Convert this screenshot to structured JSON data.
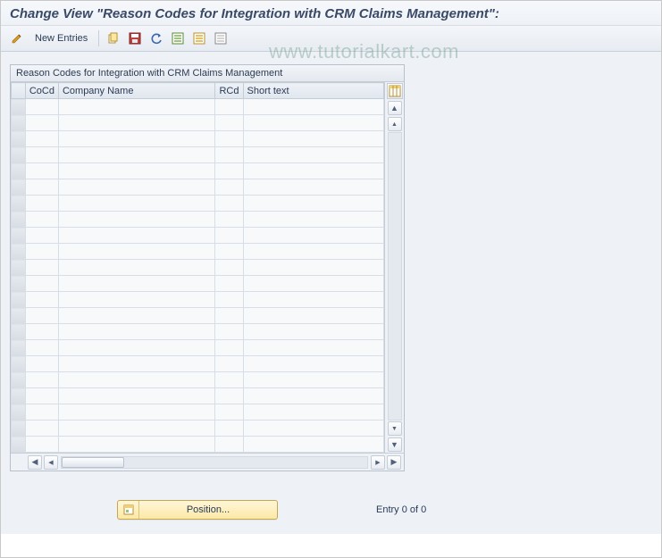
{
  "title": "Change View \"Reason Codes for Integration with CRM Claims Management\":",
  "toolbar": {
    "new_entries": "New Entries"
  },
  "watermark": "www.tutorialkart.com",
  "panel": {
    "header": "Reason Codes for Integration with CRM Claims Management",
    "columns": {
      "cocd": "CoCd",
      "company_name": "Company Name",
      "rcd": "RCd",
      "short_text": "Short text"
    },
    "row_count": 22
  },
  "footer": {
    "position_label": "Position...",
    "entry_text": "Entry 0 of 0"
  }
}
